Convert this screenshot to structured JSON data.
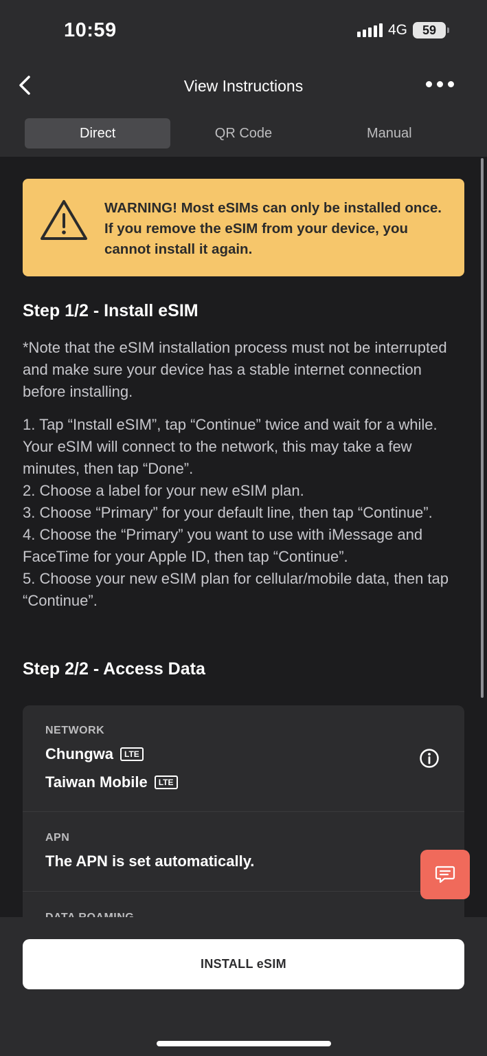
{
  "status_bar": {
    "time": "10:59",
    "network": "4G",
    "battery": "59"
  },
  "nav": {
    "title": "View Instructions",
    "back_icon": "chevron-left-icon",
    "more_icon": "ellipsis-icon"
  },
  "tabs": [
    {
      "label": "Direct",
      "active": true
    },
    {
      "label": "QR Code",
      "active": false
    },
    {
      "label": "Manual",
      "active": false
    }
  ],
  "warning": {
    "icon": "warning-triangle-icon",
    "text": "WARNING! Most eSIMs can only be installed once. If you remove the eSIM from your device, you cannot install it again.",
    "color": "#f6c66b"
  },
  "step1": {
    "title": "Step 1/2 - Install eSIM",
    "note": "*Note that the eSIM installation process must not be interrupted and make sure your device has a stable internet connection before installing.",
    "instructions": [
      "1. Tap “Install eSIM”, tap “Continue” twice and wait for a while. Your eSIM will connect to the network, this may take a few minutes, then tap “Done”.",
      "2. Choose a label for your new eSIM plan.",
      "3. Choose “Primary” for your default line, then tap “Continue”.",
      "4. Choose the “Primary” you want to use with iMessage and FaceTime for your Apple ID, then tap “Continue”.",
      "5. Choose your new eSIM plan for cellular/mobile data, then tap “Continue”."
    ]
  },
  "step2": {
    "title": "Step 2/2 - Access Data",
    "network_label": "NETWORK",
    "networks": [
      {
        "name": "Chungwa",
        "badge": "LTE"
      },
      {
        "name": "Taiwan Mobile",
        "badge": "LTE"
      }
    ],
    "apn_label": "APN",
    "apn_value": "The APN is set automatically.",
    "roaming_label": "DATA ROAMING"
  },
  "chat_button": {
    "icon": "chat-bubble-icon",
    "color": "#f06a5b"
  },
  "install_button": {
    "label": "INSTALL eSIM"
  }
}
